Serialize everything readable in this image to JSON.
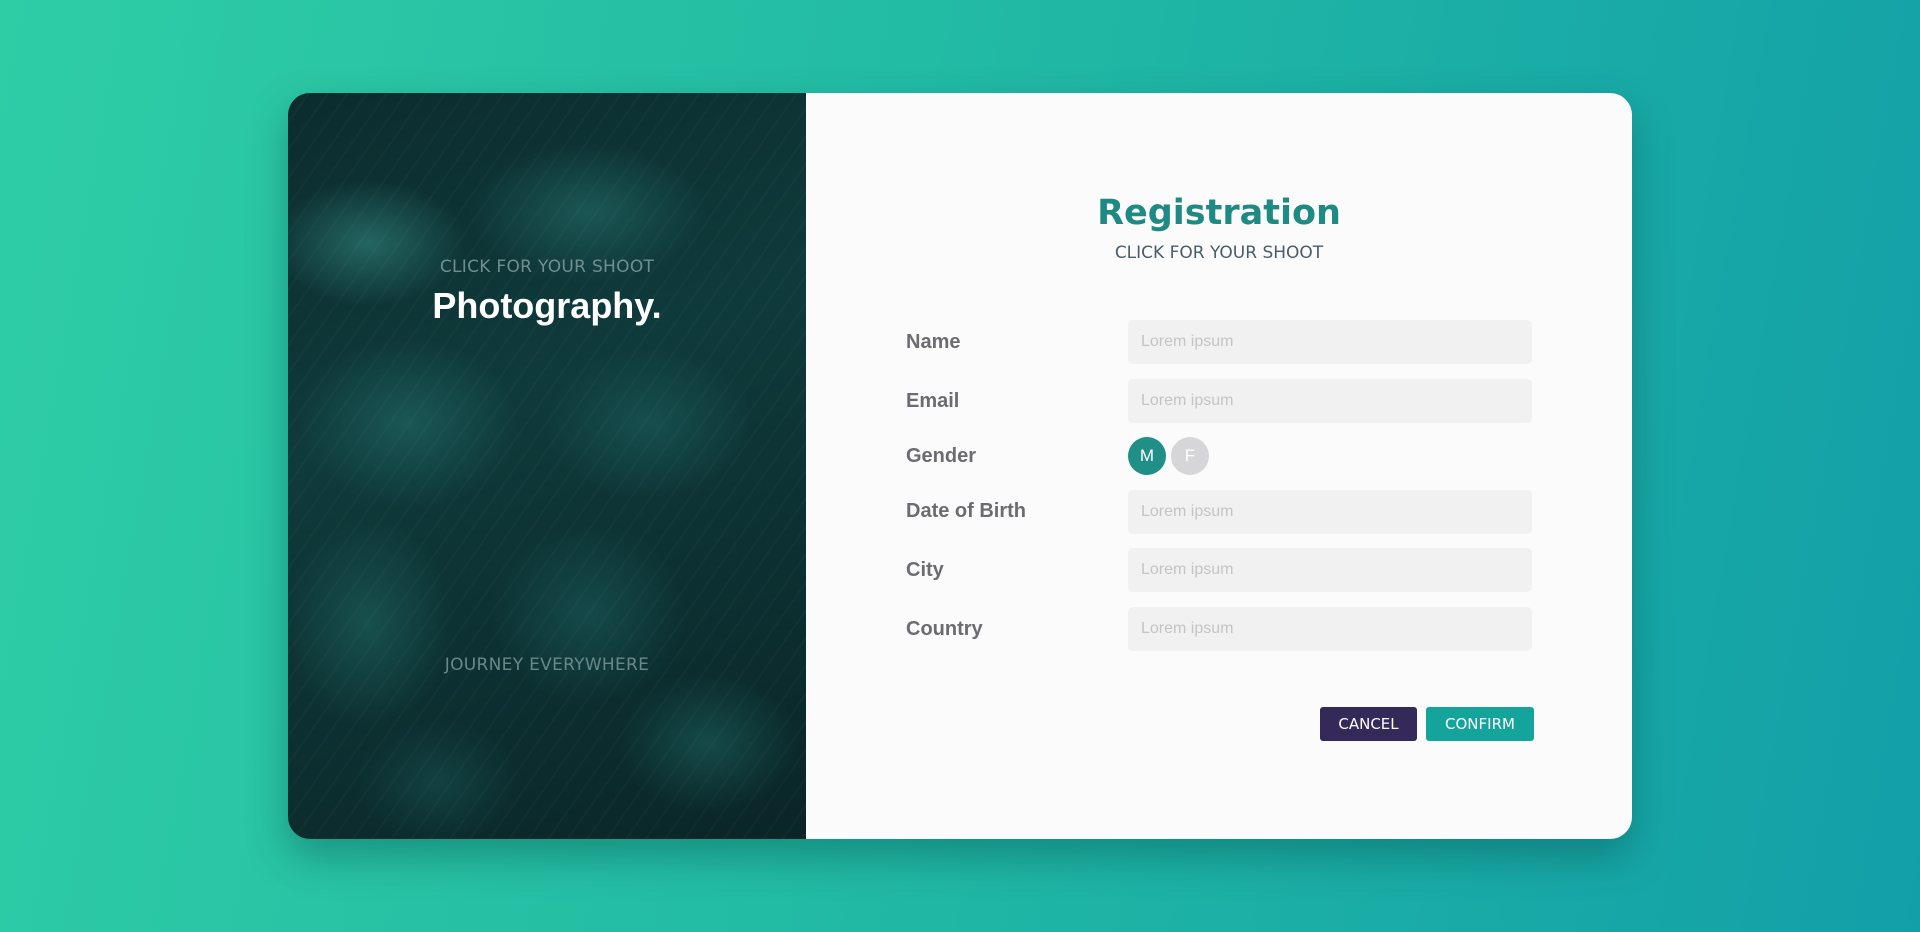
{
  "left_panel": {
    "subtitle": "CLICK FOR YOUR SHOOT",
    "title": "Photography.",
    "footer": "JOURNEY EVERYWHERE"
  },
  "form": {
    "title": "Registration",
    "subtitle": "CLICK FOR YOUR SHOOT",
    "fields": {
      "name": {
        "label": "Name",
        "placeholder": "Lorem ipsum"
      },
      "email": {
        "label": "Email",
        "placeholder": "Lorem ipsum"
      },
      "gender": {
        "label": "Gender",
        "options": [
          "M",
          "F"
        ],
        "selected": "M"
      },
      "dob": {
        "label": "Date of Birth",
        "placeholder": "Lorem ipsum"
      },
      "city": {
        "label": "City",
        "placeholder": "Lorem ipsum"
      },
      "country": {
        "label": "Country",
        "placeholder": "Lorem ipsum"
      }
    },
    "buttons": {
      "cancel": "CANCEL",
      "confirm": "CONFIRM"
    }
  },
  "colors": {
    "accent": "#1f8a84",
    "selected_gender": "#1f8f87",
    "unselected_gender": "#d6d6d9",
    "cancel_button": "#332a59",
    "confirm_button": "#15a49b"
  }
}
